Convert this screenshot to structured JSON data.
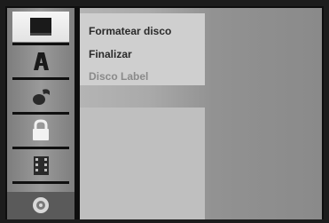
{
  "sidebar": {
    "items": [
      {
        "icon": "black-square-icon",
        "active": true
      },
      {
        "icon": "letter-a-icon",
        "active": false
      },
      {
        "icon": "music-note-icon",
        "active": false
      },
      {
        "icon": "lock-icon",
        "active": false
      },
      {
        "icon": "film-strip-icon",
        "active": false
      }
    ],
    "bottom_icon": "disc-icon"
  },
  "menu": {
    "items": [
      {
        "label": "Formatear disco",
        "enabled": true
      },
      {
        "label": "Finalizar",
        "enabled": true
      },
      {
        "label": "Disco Label",
        "enabled": false
      }
    ]
  }
}
